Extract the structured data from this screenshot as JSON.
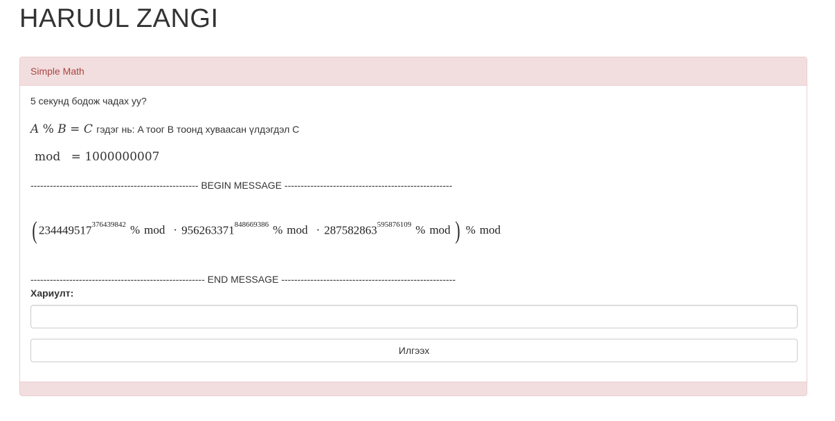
{
  "site_title": "HARUUL ZANGI",
  "panel": {
    "heading": "Simple Math",
    "intro": "5 секунд бодож чадах уу?",
    "definition": {
      "A": "A",
      "op": "%",
      "B": "B",
      "eq": "=",
      "C": "C",
      "text": "гэдэг нь: A тоог B тоонд хуваасан үлдэгдэл C"
    },
    "mod_line": {
      "name": "mod",
      "eq": "=",
      "value": "1000000007"
    },
    "begin_separator": "---------------------------------------------------- BEGIN MESSAGE ----------------------------------------------------",
    "end_separator": "------------------------------------------------------ END MESSAGE ------------------------------------------------------",
    "expression": {
      "terms": [
        {
          "base": "234449517",
          "exponent": "376439842"
        },
        {
          "base": "956263371",
          "exponent": "848669386"
        },
        {
          "base": "287582863",
          "exponent": "595876109"
        }
      ],
      "percent": "%",
      "mod": "mod",
      "dot": "·",
      "open_paren": "(",
      "close_paren": ")"
    },
    "answer_label": "Хариулт:",
    "answer_value": "",
    "submit_label": "Илгээх"
  }
}
